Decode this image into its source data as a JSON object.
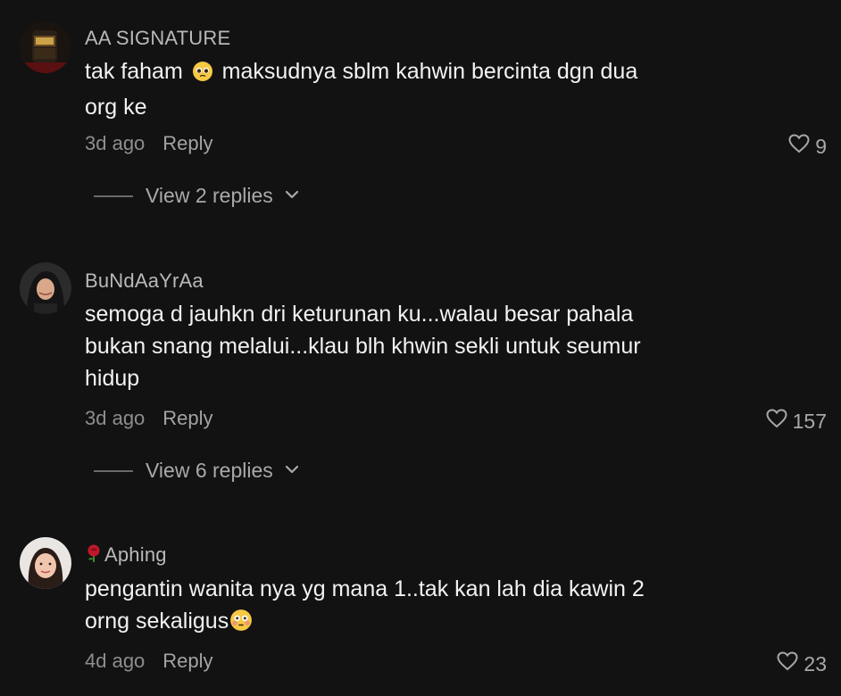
{
  "comments": [
    {
      "username": "AA SIGNATURE",
      "text_before_emoji": "tak faham ",
      "emoji": "pleading-face",
      "text_after_emoji": " maksudnya sblm kahwin bercinta dgn dua",
      "text_line2": "org ke",
      "time": "3d ago",
      "reply_label": "Reply",
      "likes": "9",
      "view_replies": "View 2 replies"
    },
    {
      "username": "BuNdAaYrAa",
      "text_line1": "semoga d jauhkn dri keturunan ku...walau besar pahala",
      "text_line2": "bukan snang melalui...klau blh khwin sekli untuk seumur",
      "text_line3": "hidup",
      "time": "3d ago",
      "reply_label": "Reply",
      "likes": "157",
      "view_replies": "View 6 replies"
    },
    {
      "username": "Aphing",
      "username_prefix_emoji": "rose",
      "text_line1": "pengantin wanita nya yg mana 1..tak kan lah dia kawin 2",
      "text_line2_before_emoji": "orng sekaligus",
      "emoji": "flushed-face",
      "time": "4d ago",
      "reply_label": "Reply",
      "likes": "23"
    }
  ],
  "colors": {
    "background": "#121212",
    "text": "#f2f2f2",
    "username": "#b9b9b9",
    "muted": "#8e8e8e"
  },
  "icons": [
    "heart-outline-icon",
    "chevron-down-icon",
    "rose-emoji",
    "pleading-face-emoji",
    "flushed-face-emoji"
  ]
}
